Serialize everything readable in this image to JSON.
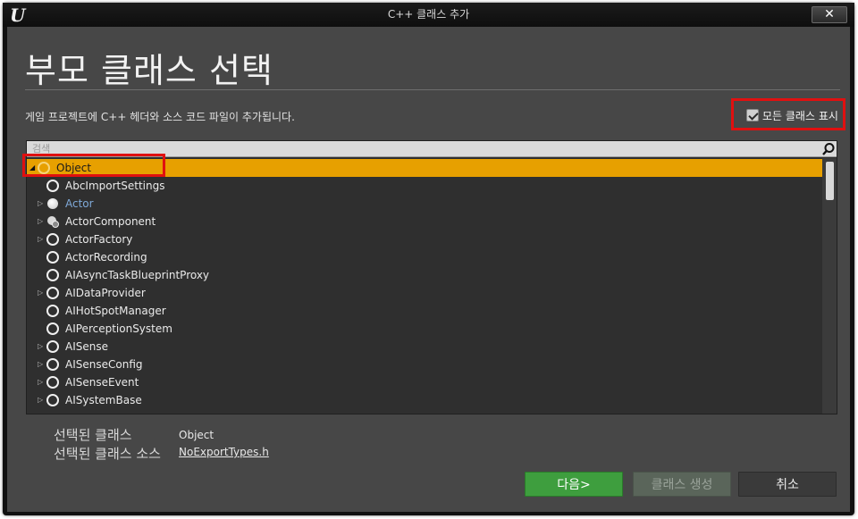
{
  "window": {
    "title": "C++ 클래스 추가",
    "close_label": "✕",
    "logo_label": "U"
  },
  "header": {
    "page_title": "부모 클래스 선택",
    "description": "게임 프로젝트에 C++ 헤더와 소스 코드 파일이 추가됩니다.",
    "show_all_label": "모든 클래스 표시",
    "show_all_checked": true
  },
  "search": {
    "placeholder": "검색"
  },
  "tree": {
    "items": [
      {
        "label": "Object",
        "icon": "ring-icon",
        "expander": "expanded",
        "selected": true
      },
      {
        "label": "AbcImportSettings",
        "icon": "ring-icon",
        "expander": "none"
      },
      {
        "label": "Actor",
        "icon": "sphere-icon",
        "expander": "collapsed",
        "highlight": true
      },
      {
        "label": "ActorComponent",
        "icon": "component-icon",
        "expander": "collapsed"
      },
      {
        "label": "ActorFactory",
        "icon": "ring-icon",
        "expander": "collapsed"
      },
      {
        "label": "ActorRecording",
        "icon": "ring-icon",
        "expander": "none"
      },
      {
        "label": "AIAsyncTaskBlueprintProxy",
        "icon": "ring-icon",
        "expander": "none"
      },
      {
        "label": "AIDataProvider",
        "icon": "ring-icon",
        "expander": "collapsed"
      },
      {
        "label": "AIHotSpotManager",
        "icon": "ring-icon",
        "expander": "none"
      },
      {
        "label": "AIPerceptionSystem",
        "icon": "ring-icon",
        "expander": "none"
      },
      {
        "label": "AISense",
        "icon": "ring-icon",
        "expander": "collapsed"
      },
      {
        "label": "AISenseConfig",
        "icon": "ring-icon",
        "expander": "collapsed"
      },
      {
        "label": "AISenseEvent",
        "icon": "ring-icon",
        "expander": "collapsed"
      },
      {
        "label": "AISystemBase",
        "icon": "ring-icon",
        "expander": "collapsed"
      }
    ]
  },
  "selection": {
    "class_label": "선택된 클래스",
    "class_value": "Object",
    "source_label": "선택된 클래스 소스",
    "source_value": "NoExportTypes.h"
  },
  "buttons": {
    "next": "다음>",
    "create": "클래스 생성",
    "cancel": "취소"
  },
  "colors": {
    "selected_row": "#e7a000",
    "next_button": "#3e9e3e",
    "highlight_box": "#e01010",
    "actor_text": "#7fa9d8"
  }
}
